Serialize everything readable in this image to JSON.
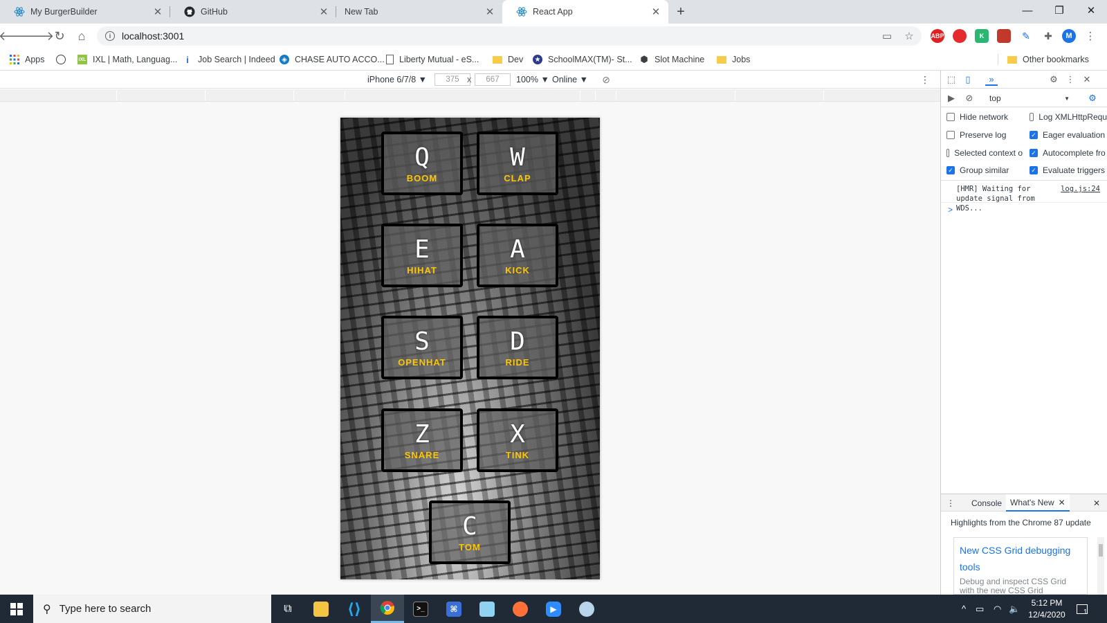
{
  "browser": {
    "tabs": [
      {
        "title": "My BurgerBuilder",
        "icon": "react-icon",
        "active": false
      },
      {
        "title": "GitHub",
        "icon": "github-icon",
        "active": false
      },
      {
        "title": "New Tab",
        "icon": "",
        "active": false
      },
      {
        "title": "React App",
        "icon": "react-icon",
        "active": true
      }
    ],
    "url": "localhost:3001",
    "profile_initial": "M",
    "bookmarks": [
      {
        "label": "Apps",
        "icon": "apps-grid-icon"
      },
      {
        "label": "",
        "icon": "globe-icon"
      },
      {
        "label": "IXL | Math, Languag...",
        "icon": "ixl-icon"
      },
      {
        "label": "Job Search | Indeed",
        "icon": "indeed-icon"
      },
      {
        "label": "CHASE AUTO ACCO...",
        "icon": "chase-icon"
      },
      {
        "label": "Liberty Mutual - eS...",
        "icon": "page-icon"
      },
      {
        "label": "Dev",
        "icon": "folder-icon"
      },
      {
        "label": "SchoolMAX(TM)- St...",
        "icon": "schoolmax-icon"
      },
      {
        "label": "Slot Machine",
        "icon": "codesandbox-icon"
      },
      {
        "label": "Jobs",
        "icon": "folder-icon"
      },
      {
        "label": "Other bookmarks",
        "icon": "folder-icon"
      }
    ],
    "extensions": [
      "ABP",
      "",
      "K",
      "",
      "",
      ""
    ]
  },
  "device_toolbar": {
    "device": "iPhone 6/7/8 ▼",
    "width": "375",
    "times": "x",
    "height": "667",
    "zoom": "100% ▼",
    "network": "Online ▼"
  },
  "drum_machine": {
    "pads": [
      {
        "key": "Q",
        "sound": "BOOM"
      },
      {
        "key": "W",
        "sound": "CLAP"
      },
      {
        "key": "E",
        "sound": "HIHAT"
      },
      {
        "key": "A",
        "sound": "KICK"
      },
      {
        "key": "S",
        "sound": "OPENHAT"
      },
      {
        "key": "D",
        "sound": "RIDE"
      },
      {
        "key": "Z",
        "sound": "SNARE"
      },
      {
        "key": "X",
        "sound": "TINK"
      },
      {
        "key": "C",
        "sound": "TOM"
      }
    ],
    "colors": {
      "sound_label": "#ffc600",
      "pad_border": "#000000"
    }
  },
  "devtools": {
    "context": "top",
    "settings": {
      "left": [
        {
          "label": "Hide network",
          "checked": false
        },
        {
          "label": "Preserve log",
          "checked": false
        },
        {
          "label": "Selected context o",
          "checked": false
        },
        {
          "label": "Group similar",
          "checked": true
        }
      ],
      "right": [
        {
          "label": "Log XMLHttpRequ",
          "checked": false
        },
        {
          "label": "Eager evaluation",
          "checked": true
        },
        {
          "label": "Autocomplete fro",
          "checked": true
        },
        {
          "label": "Evaluate triggers",
          "checked": true
        }
      ]
    },
    "log": {
      "message": "[HMR] Waiting for update signal from WDS...",
      "source": "log.js:24"
    },
    "prompt": ">",
    "drawer_tabs": [
      "Console",
      "What's New"
    ],
    "highlights": "Highlights from the Chrome 87 update",
    "card": {
      "title": "New CSS Grid debugging tools",
      "desc": "Debug and inspect CSS Grid with the new CSS Grid debugging tools."
    }
  },
  "taskbar": {
    "search_placeholder": "Type here to search",
    "time": "5:12 PM",
    "date": "12/4/2020",
    "notifications": "1"
  }
}
